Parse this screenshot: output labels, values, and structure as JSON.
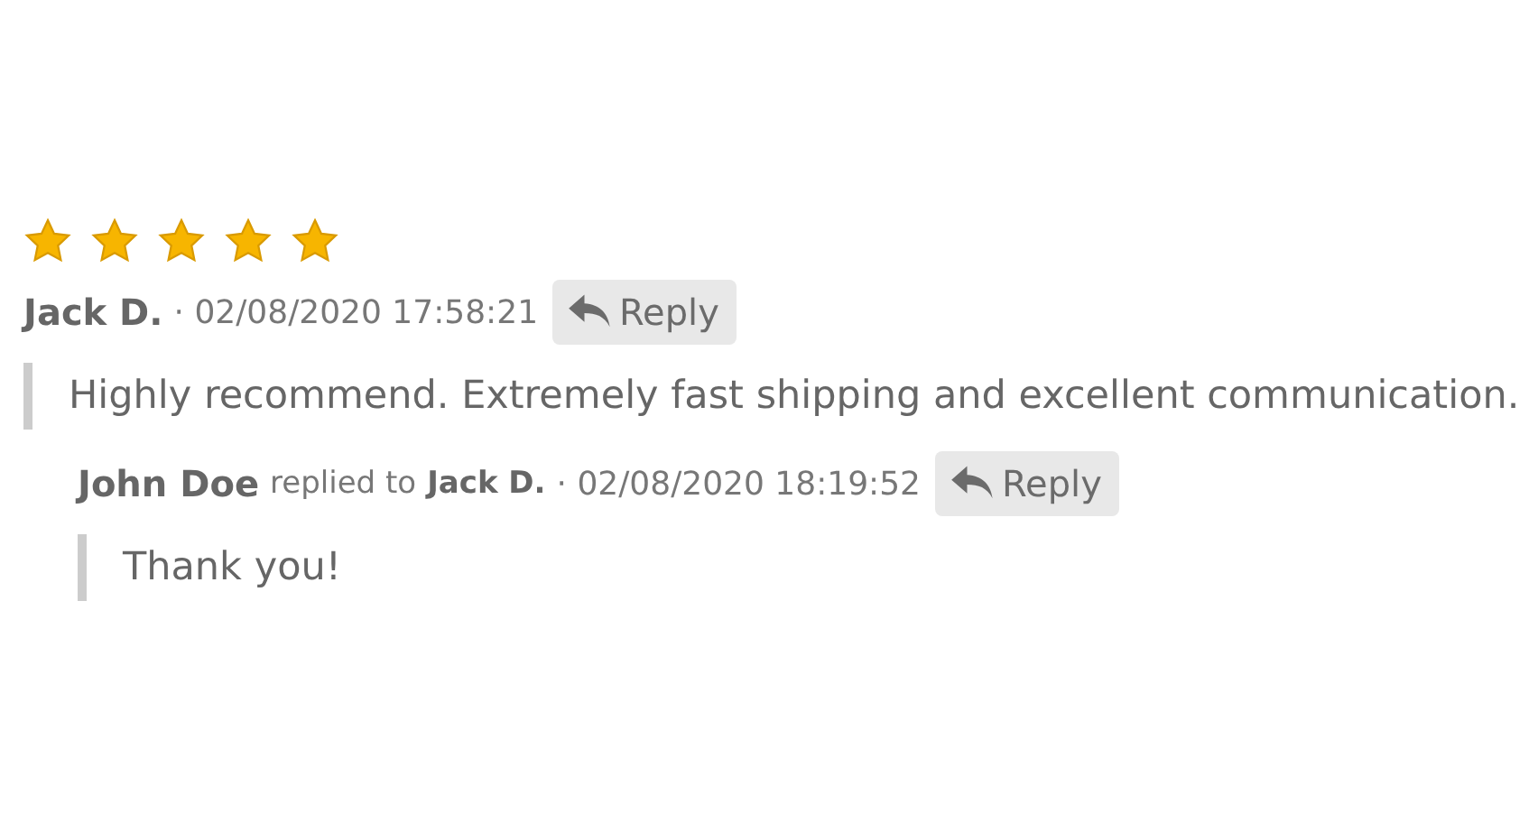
{
  "review": {
    "stars": 5,
    "author": "Jack D.",
    "date": "· 02/08/2020 17:58:21",
    "reply_button": "Reply",
    "text": "Highly recommend. Extremely fast shipping and excellent communication."
  },
  "reply": {
    "author": "John Doe",
    "replied_to_label": "replied to",
    "replied_to": "Jack D.",
    "date": "· 02/08/2020 18:19:52",
    "reply_button": "Reply",
    "text": "Thank you!"
  }
}
